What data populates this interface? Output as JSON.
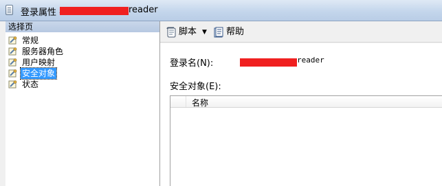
{
  "window": {
    "title_prefix": "登录属性 - ",
    "title_suffix": "reader"
  },
  "sidebar": {
    "header": "选择页",
    "items": [
      {
        "label": "常规",
        "selected": false
      },
      {
        "label": "服务器角色",
        "selected": false
      },
      {
        "label": "用户映射",
        "selected": false
      },
      {
        "label": "安全对象",
        "selected": true
      },
      {
        "label": "状态",
        "selected": false
      }
    ]
  },
  "toolbar": {
    "script_label": "脚本",
    "help_label": "帮助"
  },
  "main": {
    "login_label": "登录名(N):",
    "login_value_suffix": "reader",
    "securables_label": "安全对象(E):",
    "grid_column_name": "名称"
  },
  "colors": {
    "redaction": "#f02020",
    "selection": "#3399ff"
  }
}
